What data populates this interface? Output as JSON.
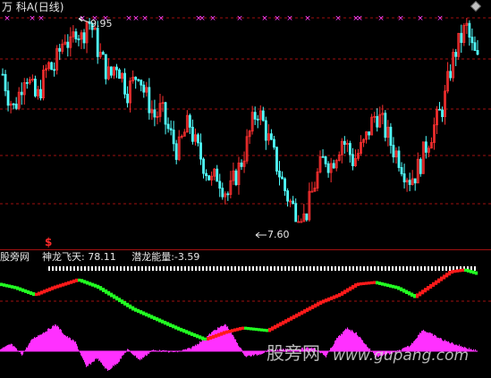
{
  "window": {
    "title": "万 科A(日线)"
  },
  "main_pane": {
    "max_label": "9.95",
    "min_label": "7.60",
    "signal_marker": "$",
    "colors": {
      "up": "#ff3030",
      "down": "#50ffff",
      "grid": "#a01010",
      "cross_marks": "#ff40ff"
    }
  },
  "indicator_pane": {
    "site_label": "股旁网",
    "line_label": "神龙飞天:",
    "line_value": "78.11",
    "hist_label": "潜龙能量:",
    "hist_value": "-3.59",
    "colors": {
      "rising": "#ff1a1a",
      "falling": "#22ff22",
      "histogram": "#ff30ff",
      "ticks": "#ffffff"
    }
  },
  "watermark": {
    "cn": "股旁网",
    "url": "www.gupang.com"
  },
  "icons": {
    "corner": "diamond-icon"
  },
  "chart_data": [
    {
      "type": "candlestick",
      "title": "万 科A(日线)",
      "ylim": [
        7.6,
        9.95
      ],
      "annotations": [
        {
          "text": "9.95",
          "value": 9.95
        },
        {
          "text": "7.60",
          "value": 7.6
        }
      ],
      "close_series": [
        9.3,
        9.05,
        8.9,
        9.1,
        9.35,
        9.15,
        9.0,
        9.2,
        9.4,
        9.35,
        9.55,
        9.75,
        9.6,
        9.85,
        9.7,
        9.95,
        9.8,
        9.55,
        9.4,
        9.25,
        9.45,
        9.3,
        9.1,
        9.2,
        9.35,
        9.1,
        8.95,
        8.8,
        8.9,
        8.7,
        8.55,
        8.4,
        8.6,
        8.75,
        8.5,
        8.35,
        8.2,
        8.05,
        8.15,
        8.0,
        7.9,
        8.1,
        8.25,
        8.45,
        8.7,
        8.9,
        8.75,
        8.55,
        8.35,
        8.15,
        7.95,
        7.8,
        7.7,
        7.6,
        7.75,
        8.0,
        8.2,
        8.35,
        8.25,
        8.4,
        8.55,
        8.45,
        8.3,
        8.4,
        8.5,
        8.7,
        8.85,
        8.75,
        8.6,
        8.45,
        8.35,
        8.2,
        8.1,
        8.15,
        8.3,
        8.5,
        8.65,
        8.8,
        8.95,
        9.3,
        9.55,
        9.7,
        9.85,
        9.6,
        9.45
      ]
    },
    {
      "type": "line",
      "series": [
        {
          "name": "神龙飞天",
          "last_value": 78.11
        },
        {
          "name": "潜龙能量",
          "last_value": -3.59
        }
      ]
    }
  ]
}
